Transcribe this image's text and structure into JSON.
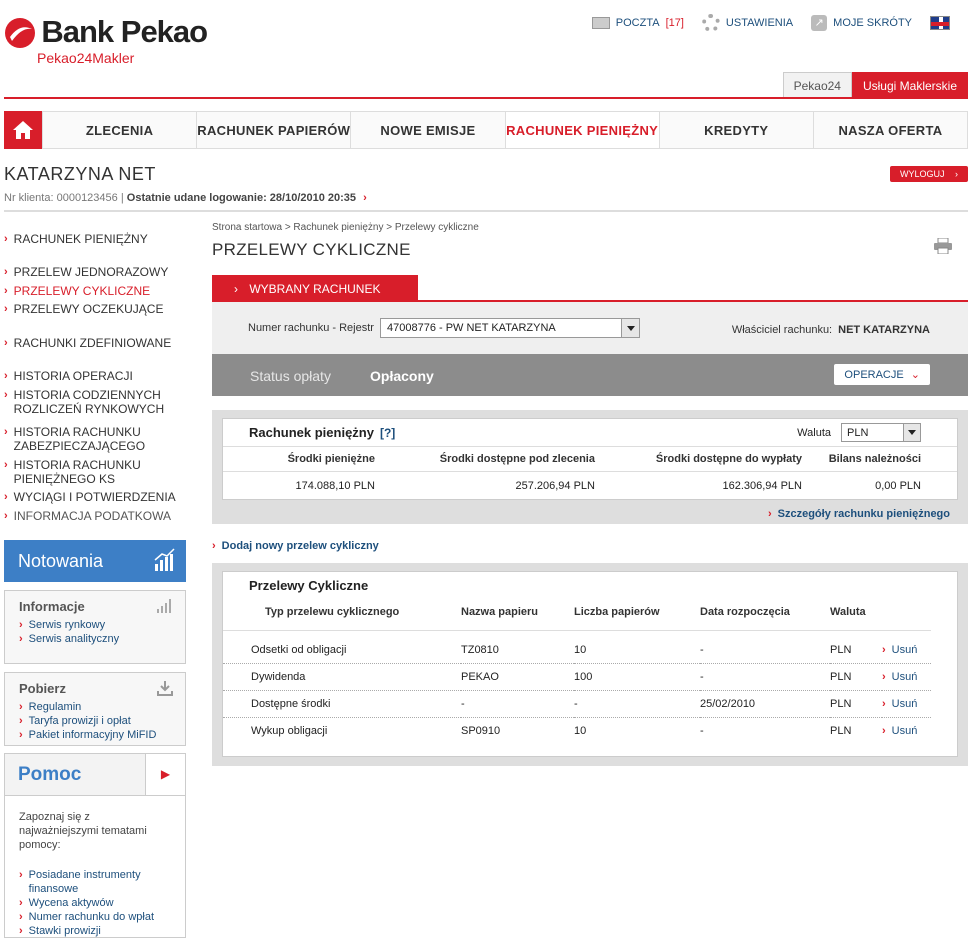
{
  "header": {
    "brand": "Bank Pekao",
    "subbrand": "Pekao24Makler",
    "links": [
      {
        "label": "POCZTA",
        "count": "[17]",
        "icon": "envelope-icon"
      },
      {
        "label": "USTAWIENIA",
        "icon": "gear-icon"
      },
      {
        "label": "MOJE SKRÓTY",
        "icon": "shortcut-icon"
      }
    ],
    "tabs": [
      "Pekao24",
      "Usługi Maklerskie"
    ]
  },
  "nav": [
    "ZLECENIA",
    "RACHUNEK PAPIERÓW",
    "NOWE EMISJE",
    "RACHUNEK PIENIĘŻNY",
    "KREDYTY",
    "NASZA OFERTA"
  ],
  "user": {
    "name": "KATARZYNA NET",
    "client_label": "Nr klienta:",
    "client_no": "0000123456",
    "last_login_label": "Ostatnie udane logowanie:",
    "last_login": "28/10/2010 20:35",
    "logout": "WYLOGUJ"
  },
  "sidebar": {
    "menu": [
      "RACHUNEK PIENIĘŻNY",
      "PRZELEW JEDNORAZOWY",
      "PRZELEWY CYKLICZNE",
      "PRZELEWY OCZEKUJĄCE",
      "RACHUNKI ZDEFINIOWANE",
      "HISTORIA OPERACJI",
      "HISTORIA CODZIENNYCH ROZLICZEŃ RYNKOWYCH",
      "HISTORIA RACHUNKU ZABEZPIECZAJĄCEGO",
      "HISTORIA RACHUNKU PIENIĘŻNEGO KS",
      "WYCIĄGI I POTWIERDZENIA",
      "INFORMACJA PODATKOWA"
    ],
    "notowania": "Notowania",
    "informacje": {
      "title": "Informacje",
      "links": [
        "Serwis rynkowy",
        "Serwis analityczny"
      ]
    },
    "pobierz": {
      "title": "Pobierz",
      "links": [
        "Regulamin",
        "Taryfa prowizji i opłat",
        "Pakiet informacyjny MiFID"
      ]
    },
    "pomoc": {
      "title": "Pomoc",
      "intro": "Zapoznaj się z najważniejszymi tematami pomocy:",
      "links": [
        "Posiadane instrumenty finansowe",
        "Wycena aktywów",
        "Numer rachunku do wpłat",
        "Stawki prowizji"
      ]
    }
  },
  "content": {
    "breadcrumb": "Strona startowa > Rachunek pieniężny > Przelewy cykliczne",
    "title": "PRZELEWY CYKLICZNE",
    "acct_tab": "WYBRANY RACHUNEK",
    "acct_label": "Numer rachunku - Rejestr",
    "acct_value": "47008776 - PW NET KATARZYNA",
    "owner_label": "Właściciel rachunku:",
    "owner_value": "NET KATARZYNA",
    "status_label": "Status opłaty",
    "status_value": "Opłacony",
    "operations": "OPERACJE",
    "balance": {
      "title": "Rachunek pieniężny",
      "help": "[?]",
      "currency_label": "Waluta",
      "currency": "PLN",
      "headers": [
        "Środki pieniężne",
        "Środki dostępne pod zlecenia",
        "Środki dostępne do wypłaty",
        "Bilans należności"
      ],
      "values": [
        "174.088,10  PLN",
        "257.206,94  PLN",
        "162.306,94  PLN",
        "0,00  PLN"
      ]
    },
    "details_link": "Szczegóły rachunku pieniężnego",
    "add_link": "Dodaj nowy przelew cykliczny",
    "recurring": {
      "title": "Przelewy Cykliczne",
      "headers": [
        "Typ przelewu cyklicznego",
        "Nazwa papieru",
        "Liczba papierów",
        "Data rozpoczęcia",
        "Waluta",
        ""
      ],
      "rows": [
        [
          "Odsetki od obligacji",
          "TZ0810",
          "10",
          "-",
          "PLN",
          "Usuń"
        ],
        [
          "Dywidenda",
          "PEKAO",
          "100",
          "-",
          "PLN",
          "Usuń"
        ],
        [
          "Dostępne środki",
          "-",
          "-",
          "25/02/2010",
          "PLN",
          "Usuń"
        ],
        [
          "Wykup obligacji",
          "SP0910",
          "10",
          "-",
          "PLN",
          "Usuń"
        ]
      ]
    }
  },
  "colors": {
    "brand_red": "#d81e2a",
    "link_blue": "#1d4f7c",
    "notowania_blue": "#3d7fc6"
  }
}
